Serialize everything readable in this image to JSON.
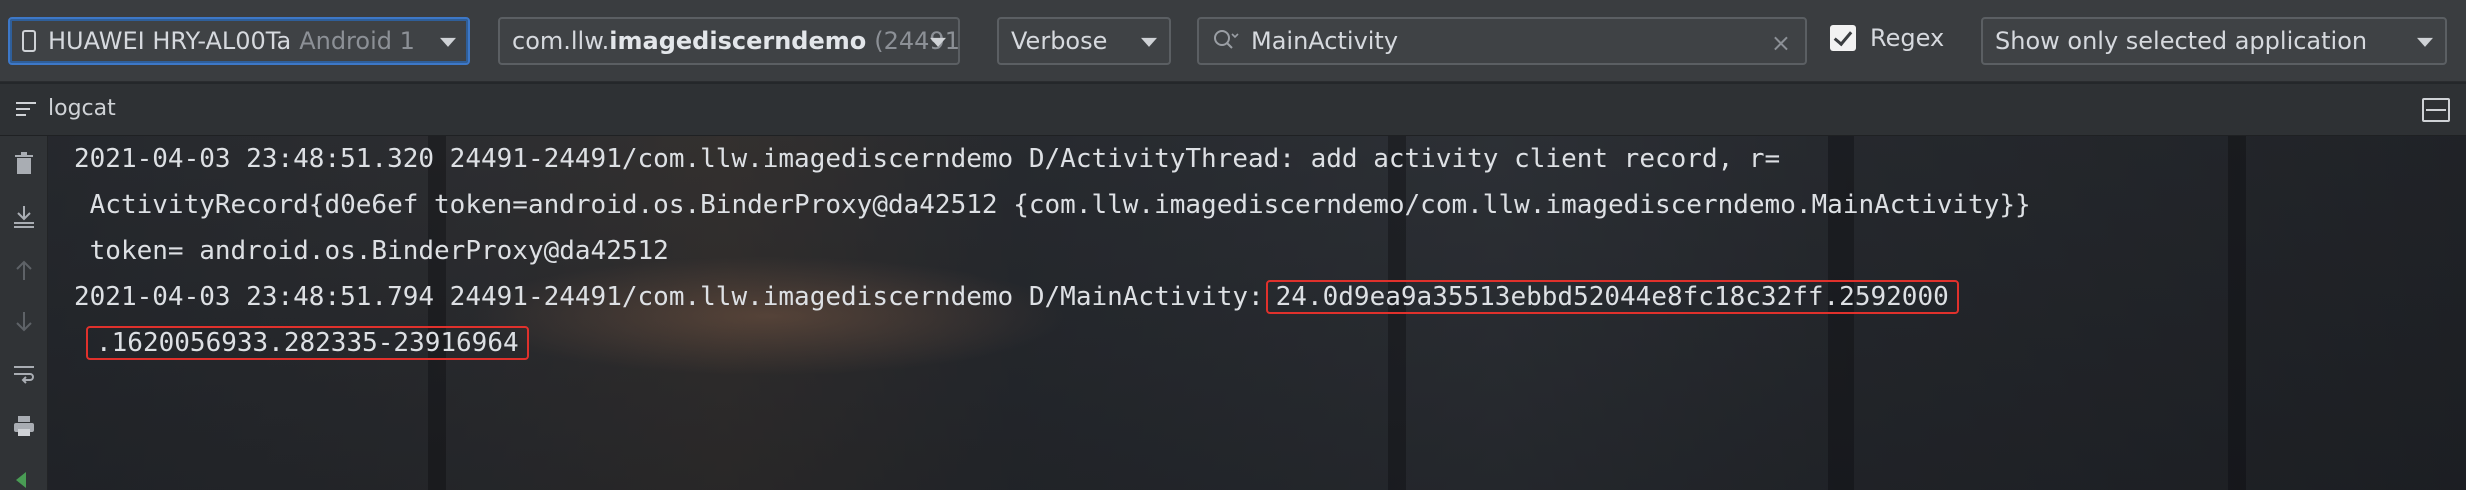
{
  "toolbar": {
    "device": {
      "name": "HUAWEI HRY-AL00Ta",
      "detail": "Android 1"
    },
    "process": {
      "prefix": "com.llw.",
      "bold": "imagediscerndemo",
      "pid": "(24491"
    },
    "log_level": "Verbose",
    "search": {
      "value": "MainActivity",
      "clear_icon": "×"
    },
    "regex": {
      "label": "Regex",
      "checked": true
    },
    "filter": "Show only selected application"
  },
  "panel": {
    "title": "logcat"
  },
  "gutter": {
    "icons": [
      "trash-icon",
      "scroll-to-end-icon",
      "up-arrow-icon",
      "down-arrow-icon",
      "soft-wrap-icon",
      "print-icon",
      "restart-icon"
    ]
  },
  "log": {
    "lines": [
      "2021-04-03 23:48:51.320 24491-24491/com.llw.imagediscerndemo D/ActivityThread: add activity client record, r=",
      " ActivityRecord{d0e6ef token=android.os.BinderProxy@da42512 {com.llw.imagediscerndemo/com.llw.imagediscerndemo.MainActivity}}",
      " token= android.os.BinderProxy@da42512"
    ],
    "entry2_prefix": "2021-04-03 23:48:51.794 24491-24491/com.llw.imagediscerndemo D/MainActivity:",
    "entry2_highlight_1": "24.0d9ea9a35513ebbd52044e8fc18c32ff.2592000",
    "entry2_highlight_2": ".1620056933.282335-23916964"
  },
  "colors": {
    "highlight_border": "#e0312c",
    "focus_border": "#3d78c8"
  }
}
